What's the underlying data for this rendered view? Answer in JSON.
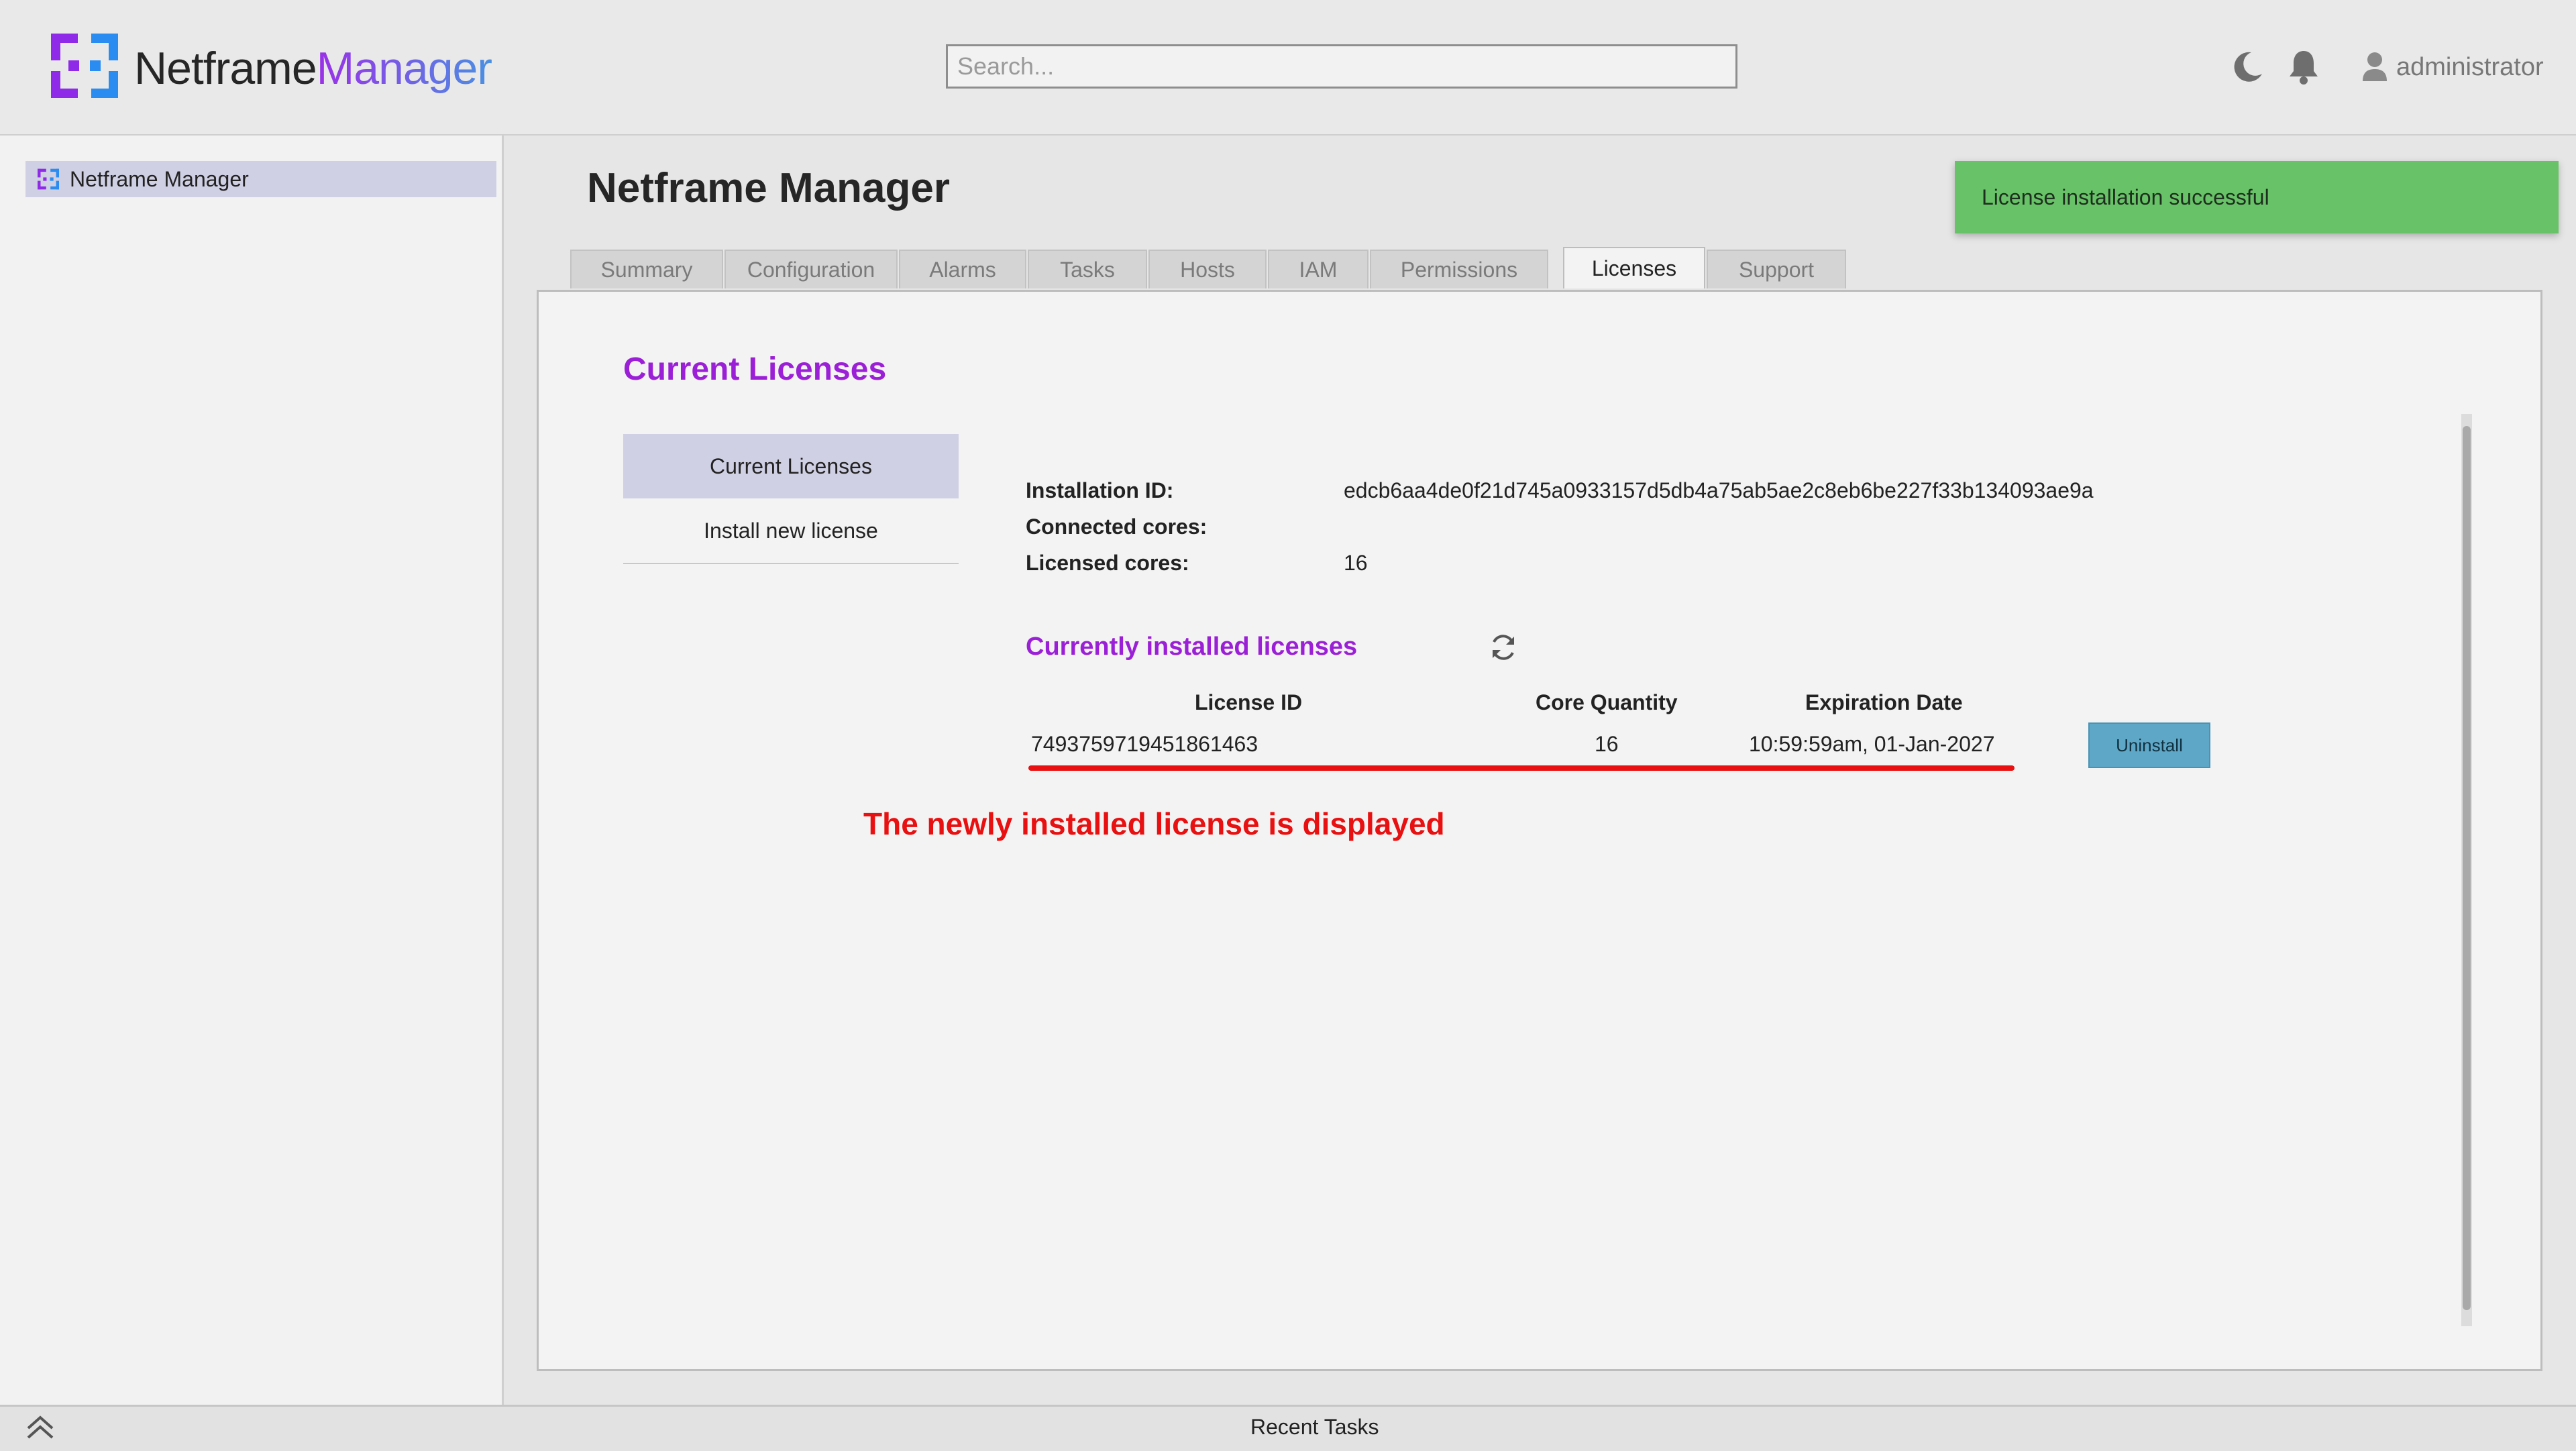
{
  "header": {
    "brand_part1": "Netframe",
    "brand_part2": "Manager",
    "search_placeholder": "Search...",
    "icons": [
      "moon-icon",
      "bell-icon",
      "user-icon"
    ],
    "username": "administrator"
  },
  "sidebar": {
    "items": [
      {
        "label": "Netframe Manager",
        "icon": "netframe-logo-icon",
        "selected": true
      }
    ]
  },
  "main": {
    "title": "Netframe Manager",
    "toast": "License installation successful",
    "tabs": [
      {
        "label": "Summary"
      },
      {
        "label": "Configuration"
      },
      {
        "label": "Alarms"
      },
      {
        "label": "Tasks"
      },
      {
        "label": "Hosts"
      },
      {
        "label": "IAM"
      },
      {
        "label": "Permissions"
      },
      {
        "label": "Licenses",
        "active": true
      },
      {
        "label": "Support"
      }
    ]
  },
  "licenses": {
    "section_title": "Current Licenses",
    "subnav": [
      {
        "label": "Current Licenses",
        "active": true
      },
      {
        "label": "Install new license"
      }
    ],
    "info": {
      "installation_id_label": "Installation ID:",
      "installation_id": "edcb6aa4de0f21d745a0933157d5db4a75ab5ae2c8eb6be227f33b134093ae9a",
      "connected_cores_label": "Connected cores:",
      "connected_cores": "",
      "licensed_cores_label": "Licensed cores:",
      "licensed_cores": "16"
    },
    "installed_title": "Currently installed licenses",
    "table": {
      "headers": [
        "License ID",
        "Core Quantity",
        "Expiration Date"
      ],
      "rows": [
        {
          "license_id": "7493759719451861463",
          "core_quantity": "16",
          "expiration": "10:59:59am, 01-Jan-2027",
          "action": "Uninstall"
        }
      ]
    },
    "annotation": "The newly installed license is displayed"
  },
  "footer": {
    "label": "Recent Tasks"
  },
  "colors": {
    "accent_purple": "#9b1fd6",
    "toast_green": "#68c268",
    "annotation_red": "#e81010",
    "button_blue": "#5fa7c7",
    "selected_bg": "#cfd0e4"
  }
}
